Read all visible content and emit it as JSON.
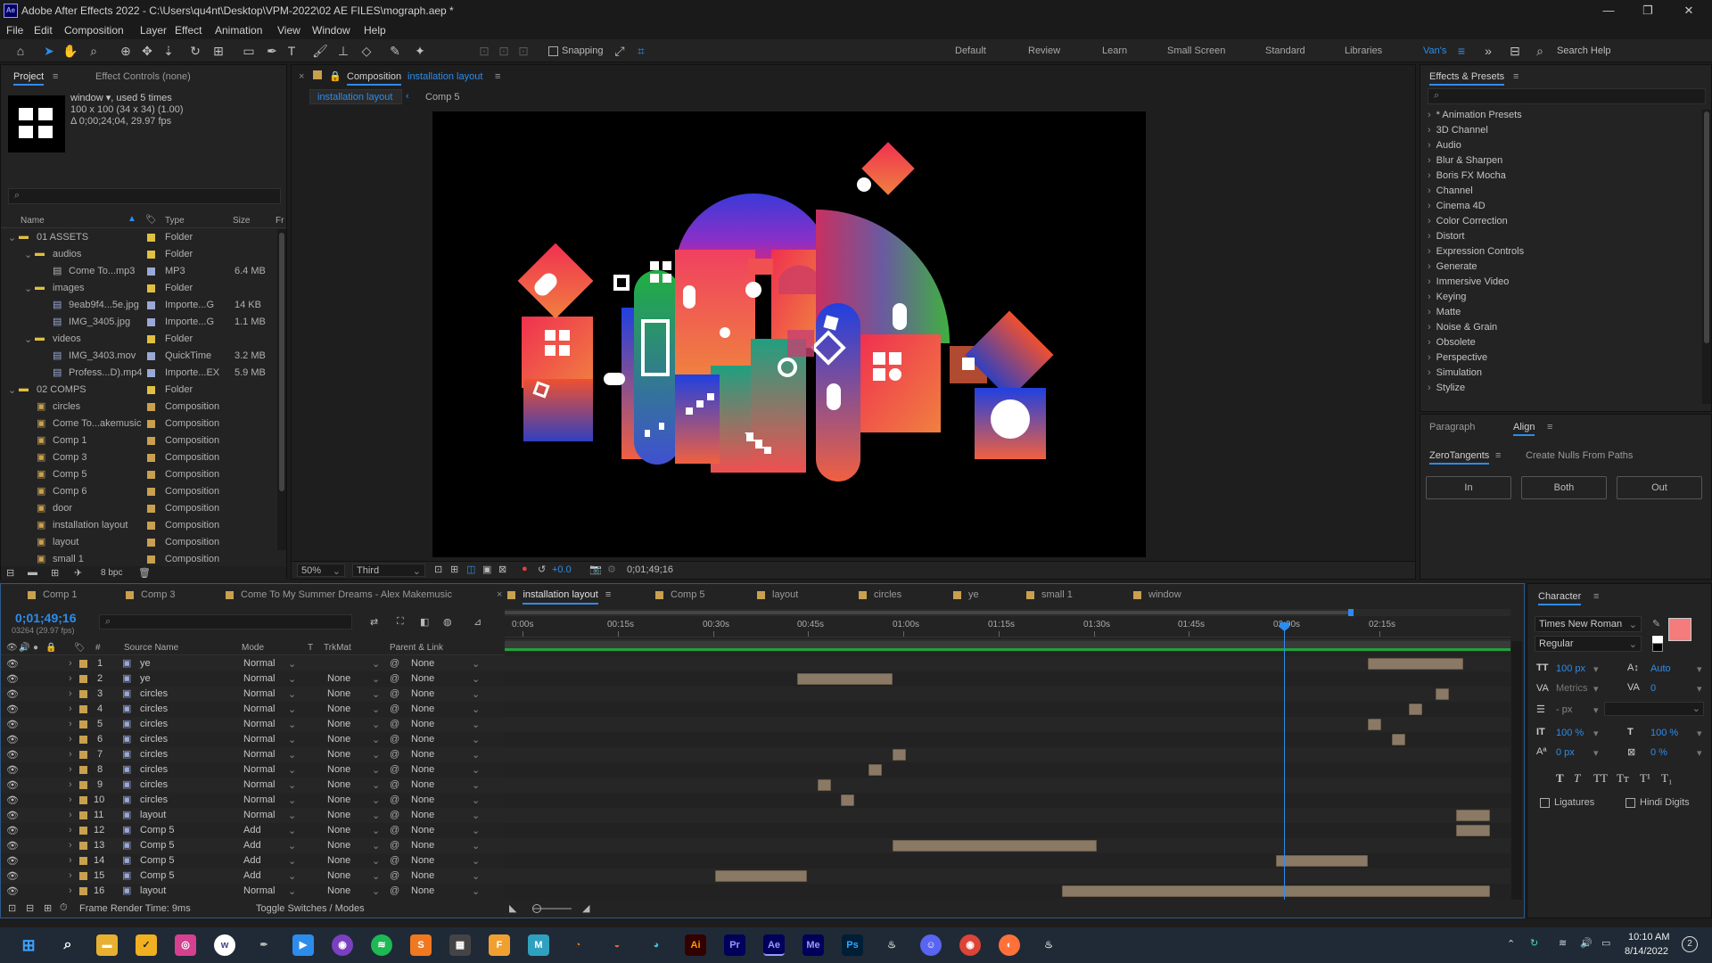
{
  "window": {
    "title": "Adobe After Effects 2022 - C:\\Users\\qu4nt\\Desktop\\VPM-2022\\02 AE FILES\\mograph.aep *"
  },
  "menu": [
    "File",
    "Edit",
    "Composition",
    "Layer",
    "Effect",
    "Animation",
    "View",
    "Window",
    "Help"
  ],
  "toolbar": {
    "snapping": "Snapping",
    "workspaces": [
      "Default",
      "Review",
      "Learn",
      "Small Screen",
      "Standard",
      "Libraries",
      "Van's"
    ],
    "search_help": "Search Help"
  },
  "project": {
    "tab_project": "Project",
    "tab_effect_controls": "Effect Controls (none)",
    "item_name": "window",
    "used": ", used 5 times",
    "dims": "100 x 100  (34 x 34) (1.00)",
    "duration": "Δ 0;00;24;04, 29.97 fps",
    "columns": {
      "name": "Name",
      "type": "Type",
      "size": "Size",
      "fr": "Fr"
    },
    "items": [
      {
        "name": "01 ASSETS",
        "type": "Folder",
        "size": "",
        "indent": 0,
        "kind": "folder",
        "color": "#e0c040"
      },
      {
        "name": "audios",
        "type": "Folder",
        "size": "",
        "indent": 1,
        "kind": "folder",
        "color": "#e0c040"
      },
      {
        "name": "Come To...mp3",
        "type": "MP3",
        "size": "6.4 MB",
        "indent": 2,
        "kind": "file",
        "color": "#b0b0b0"
      },
      {
        "name": "images",
        "type": "Folder",
        "size": "",
        "indent": 1,
        "kind": "folder",
        "color": "#e0c040"
      },
      {
        "name": "9eab9f4...5e.jpg",
        "type": "Importe...G",
        "size": "14 KB",
        "indent": 2,
        "kind": "file",
        "color": "#9aa8d6"
      },
      {
        "name": "IMG_3405.jpg",
        "type": "Importe...G",
        "size": "1.1 MB",
        "indent": 2,
        "kind": "file",
        "color": "#9aa8d6"
      },
      {
        "name": "videos",
        "type": "Folder",
        "size": "",
        "indent": 1,
        "kind": "folder",
        "color": "#e0c040"
      },
      {
        "name": "IMG_3403.mov",
        "type": "QuickTime",
        "size": "3.2 MB",
        "indent": 2,
        "kind": "file",
        "color": "#9aa8d6"
      },
      {
        "name": "Profess...D).mp4",
        "type": "Importe...EX",
        "size": "5.9 MB",
        "indent": 2,
        "kind": "file",
        "color": "#9aa8d6"
      },
      {
        "name": "02 COMPS",
        "type": "Folder",
        "size": "",
        "indent": 0,
        "kind": "folder",
        "color": "#e0c040"
      },
      {
        "name": "circles",
        "type": "Composition",
        "size": "",
        "indent": 1,
        "kind": "comp",
        "color": "#c8a050"
      },
      {
        "name": "Come To...akemusic",
        "type": "Composition",
        "size": "",
        "indent": 1,
        "kind": "comp",
        "color": "#c8a050"
      },
      {
        "name": "Comp 1",
        "type": "Composition",
        "size": "",
        "indent": 1,
        "kind": "comp",
        "color": "#c8a050"
      },
      {
        "name": "Comp 3",
        "type": "Composition",
        "size": "",
        "indent": 1,
        "kind": "comp",
        "color": "#c8a050"
      },
      {
        "name": "Comp 5",
        "type": "Composition",
        "size": "",
        "indent": 1,
        "kind": "comp",
        "color": "#c8a050"
      },
      {
        "name": "Comp 6",
        "type": "Composition",
        "size": "",
        "indent": 1,
        "kind": "comp",
        "color": "#c8a050"
      },
      {
        "name": "door",
        "type": "Composition",
        "size": "",
        "indent": 1,
        "kind": "comp",
        "color": "#c8a050"
      },
      {
        "name": "installation layout",
        "type": "Composition",
        "size": "",
        "indent": 1,
        "kind": "comp",
        "color": "#c8a050"
      },
      {
        "name": "layout",
        "type": "Composition",
        "size": "",
        "indent": 1,
        "kind": "comp",
        "color": "#c8a050"
      },
      {
        "name": "small 1",
        "type": "Composition",
        "size": "",
        "indent": 1,
        "kind": "comp",
        "color": "#c8a050"
      }
    ],
    "bpc": "8 bpc"
  },
  "composition": {
    "panel_label": "Composition",
    "name": "installation layout",
    "breadcrumb": [
      "installation layout",
      "Comp 5"
    ],
    "zoom": "50%",
    "resolution": "Third",
    "exposure": "+0.0",
    "timecode": "0;01;49;16"
  },
  "effects": {
    "title": "Effects & Presets",
    "items": [
      "* Animation Presets",
      "3D Channel",
      "Audio",
      "Blur & Sharpen",
      "Boris FX Mocha",
      "Channel",
      "Cinema 4D",
      "Color Correction",
      "Distort",
      "Expression Controls",
      "Generate",
      "Immersive Video",
      "Keying",
      "Matte",
      "Noise & Grain",
      "Obsolete",
      "Perspective",
      "Simulation",
      "Stylize"
    ]
  },
  "align": {
    "tab_paragraph": "Paragraph",
    "tab_align": "Align",
    "tab_zero": "ZeroTangents",
    "tab_nulls": "Create Nulls From Paths",
    "buttons": [
      "In",
      "Both",
      "Out"
    ]
  },
  "timeline": {
    "tabs": [
      "Comp 1",
      "Comp 3",
      "Come To My Summer Dreams - Alex Makemusic",
      "installation layout",
      "Comp 5",
      "layout",
      "circles",
      "ye",
      "small 1",
      "window"
    ],
    "timecode": "0;01;49;16",
    "frames": "03264 (29.97 fps)",
    "col_source": "Source Name",
    "col_mode": "Mode",
    "col_t": "T",
    "col_trkmat": "TrkMat",
    "col_parent": "Parent & Link",
    "ruler": [
      "0:00s",
      "00:15s",
      "00:30s",
      "00:45s",
      "01:00s",
      "01:15s",
      "01:30s",
      "01:45s",
      "02:00s",
      "02:15s"
    ],
    "layers": [
      {
        "num": "1",
        "name": "ye",
        "mode": "Normal",
        "trkmat": "",
        "parent": "None",
        "bar_start": 127,
        "bar_len": 14
      },
      {
        "num": "2",
        "name": "ye",
        "mode": "Normal",
        "trkmat": "None",
        "parent": "None",
        "bar_start": 43,
        "bar_len": 14
      },
      {
        "num": "3",
        "name": "circles",
        "mode": "Normal",
        "trkmat": "None",
        "parent": "None",
        "bar_start": 137,
        "bar_len": 2
      },
      {
        "num": "4",
        "name": "circles",
        "mode": "Normal",
        "trkmat": "None",
        "parent": "None",
        "bar_start": 133,
        "bar_len": 2
      },
      {
        "num": "5",
        "name": "circles",
        "mode": "Normal",
        "trkmat": "None",
        "parent": "None",
        "bar_start": 127,
        "bar_len": 2
      },
      {
        "num": "6",
        "name": "circles",
        "mode": "Normal",
        "trkmat": "None",
        "parent": "None",
        "bar_start": 130.5,
        "bar_len": 2
      },
      {
        "num": "7",
        "name": "circles",
        "mode": "Normal",
        "trkmat": "None",
        "parent": "None",
        "bar_start": 57,
        "bar_len": 2
      },
      {
        "num": "8",
        "name": "circles",
        "mode": "Normal",
        "trkmat": "None",
        "parent": "None",
        "bar_start": 53.5,
        "bar_len": 2
      },
      {
        "num": "9",
        "name": "circles",
        "mode": "Normal",
        "trkmat": "None",
        "parent": "None",
        "bar_start": 46,
        "bar_len": 2
      },
      {
        "num": "10",
        "name": "circles",
        "mode": "Normal",
        "trkmat": "None",
        "parent": "None",
        "bar_start": 49.5,
        "bar_len": 2
      },
      {
        "num": "11",
        "name": "layout",
        "mode": "Normal",
        "trkmat": "None",
        "parent": "None",
        "bar_start": 140,
        "bar_len": 5
      },
      {
        "num": "12",
        "name": "Comp 5",
        "mode": "Add",
        "trkmat": "None",
        "parent": "None",
        "bar_start": 140,
        "bar_len": 5
      },
      {
        "num": "13",
        "name": "Comp 5",
        "mode": "Add",
        "trkmat": "None",
        "parent": "None",
        "bar_start": 57,
        "bar_len": 30
      },
      {
        "num": "14",
        "name": "Comp 5",
        "mode": "Add",
        "trkmat": "None",
        "parent": "None",
        "bar_start": 113.5,
        "bar_len": 13.5
      },
      {
        "num": "15",
        "name": "Comp 5",
        "mode": "Add",
        "trkmat": "None",
        "parent": "None",
        "bar_start": 31,
        "bar_len": 13.5
      },
      {
        "num": "16",
        "name": "layout",
        "mode": "Normal",
        "trkmat": "None",
        "parent": "None",
        "bar_start": 82,
        "bar_len": 63
      }
    ],
    "frame_render": "Frame Render Time:  9ms",
    "toggle": "Toggle Switches / Modes"
  },
  "character": {
    "title": "Character",
    "font": "Times New Roman",
    "style": "Regular",
    "size": "100 px",
    "leading": "Auto",
    "kerning": "Metrics",
    "tracking": "0",
    "stroke": "- px",
    "vscale": "100 %",
    "hscale": "100 %",
    "baseline": "0 px",
    "tsume": "0 %",
    "ligatures": "Ligatures",
    "hindi": "Hindi Digits",
    "fill_color": "#f47c7c"
  },
  "taskbar": {
    "time": "10:10 AM",
    "date": "8/14/2022",
    "notif": "2"
  }
}
